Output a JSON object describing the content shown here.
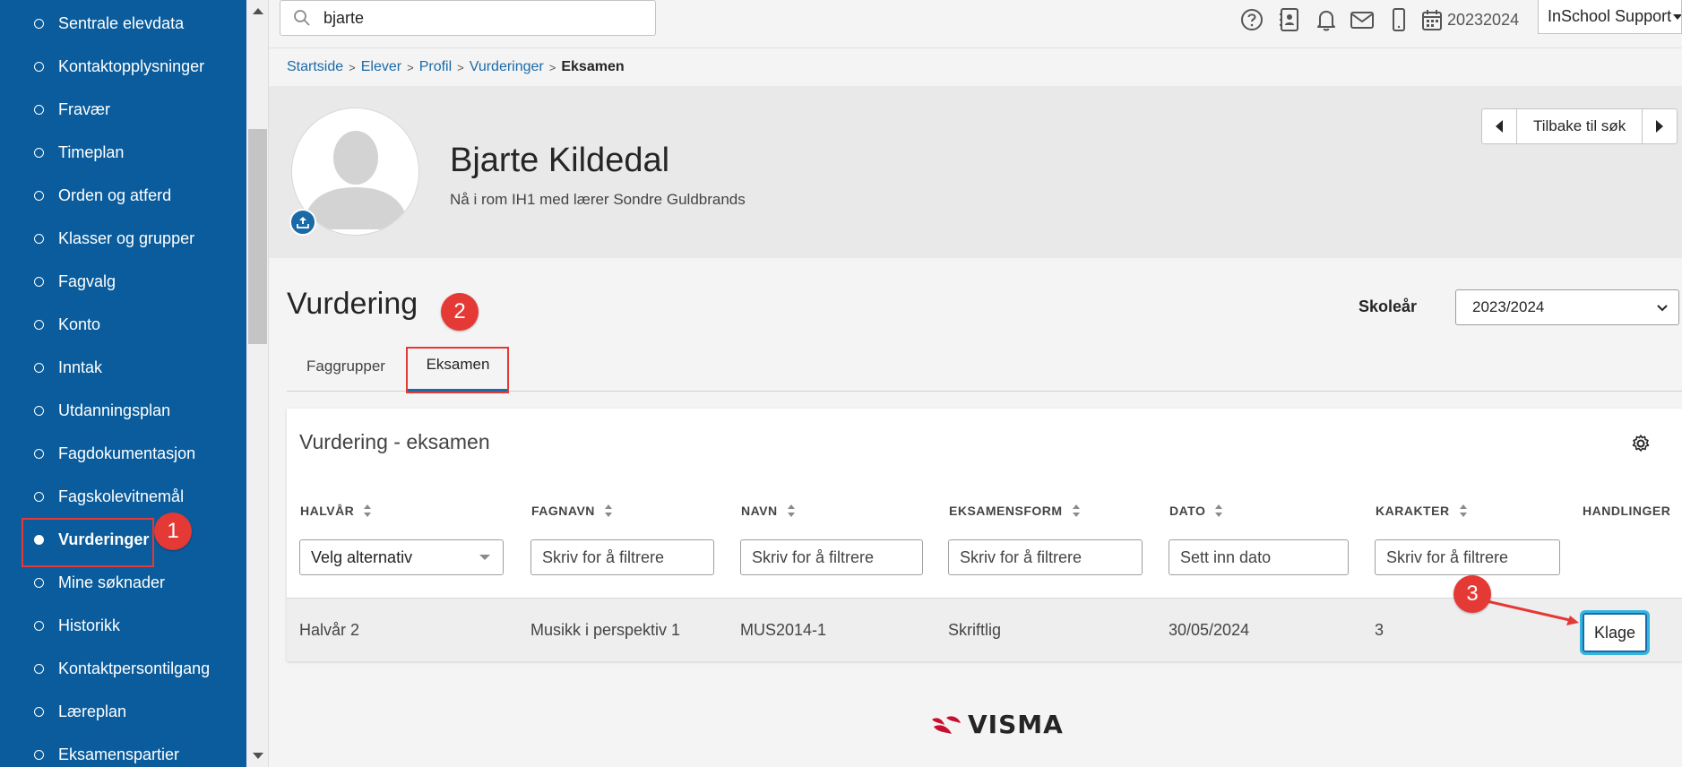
{
  "sidebar": {
    "items": [
      {
        "label": "Sentrale elevdata"
      },
      {
        "label": "Kontaktopplysninger"
      },
      {
        "label": "Fravær"
      },
      {
        "label": "Timeplan"
      },
      {
        "label": "Orden og atferd"
      },
      {
        "label": "Klasser og grupper"
      },
      {
        "label": "Fagvalg"
      },
      {
        "label": "Konto"
      },
      {
        "label": "Inntak"
      },
      {
        "label": "Utdanningsplan"
      },
      {
        "label": "Fagdokumentasjon"
      },
      {
        "label": "Fagskolevitnemål"
      },
      {
        "label": "Vurderinger"
      },
      {
        "label": "Mine søknader"
      },
      {
        "label": "Historikk"
      },
      {
        "label": "Kontaktpersontilgang"
      },
      {
        "label": "Læreplan"
      },
      {
        "label": "Eksamenspartier"
      }
    ],
    "active_index": 12
  },
  "topbar": {
    "search_value": "bjarte",
    "icons": [
      "help-icon",
      "contacts-icon",
      "bell-icon",
      "mail-icon",
      "mobile-icon",
      "calendar-icon"
    ],
    "year": "20232024",
    "user": "InSchool Support"
  },
  "breadcrumb": {
    "items": [
      "Startside",
      "Elever",
      "Profil",
      "Vurderinger"
    ],
    "current": "Eksamen"
  },
  "profile": {
    "name": "Bjarte Kildedal",
    "location": "Nå i rom IH1 med lærer Sondre Guldbrands",
    "back_label": "Tilbake til søk"
  },
  "section": {
    "title": "Vurdering",
    "schoolyear_label": "Skoleår",
    "schoolyear_value": "2023/2024"
  },
  "tabs": [
    {
      "label": "Faggrupper",
      "active": false
    },
    {
      "label": "Eksamen",
      "active": true
    }
  ],
  "annotations": {
    "badge1": "1",
    "badge2": "2",
    "badge3": "3",
    "color": "#e53935"
  },
  "card": {
    "title": "Vurdering - eksamen",
    "columns": [
      "HALVÅR",
      "FAGNAVN",
      "NAVN",
      "EKSAMENSFORM",
      "DATO",
      "KARAKTER",
      "HANDLINGER"
    ],
    "filters": {
      "halvar": "Velg alternativ",
      "fagnavn": "Skriv for å filtrere",
      "navn": "Skriv for å filtrere",
      "eksamensform": "Skriv for å filtrere",
      "dato": "Sett inn dato",
      "karakter": "Skriv for å filtrere"
    },
    "rows": [
      {
        "halvar": "Halvår 2",
        "fagnavn": "Musikk i perspektiv 1",
        "navn": "MUS2014-1",
        "eksamensform": "Skriftlig",
        "dato": "30/05/2024",
        "karakter": "3",
        "action": "Klage"
      }
    ]
  },
  "footer": {
    "logo_text": "VISMA"
  },
  "colors": {
    "sidebar_bg": "#0a5c9c",
    "accent": "#1b6aa8",
    "highlight": "#34b5e0"
  }
}
